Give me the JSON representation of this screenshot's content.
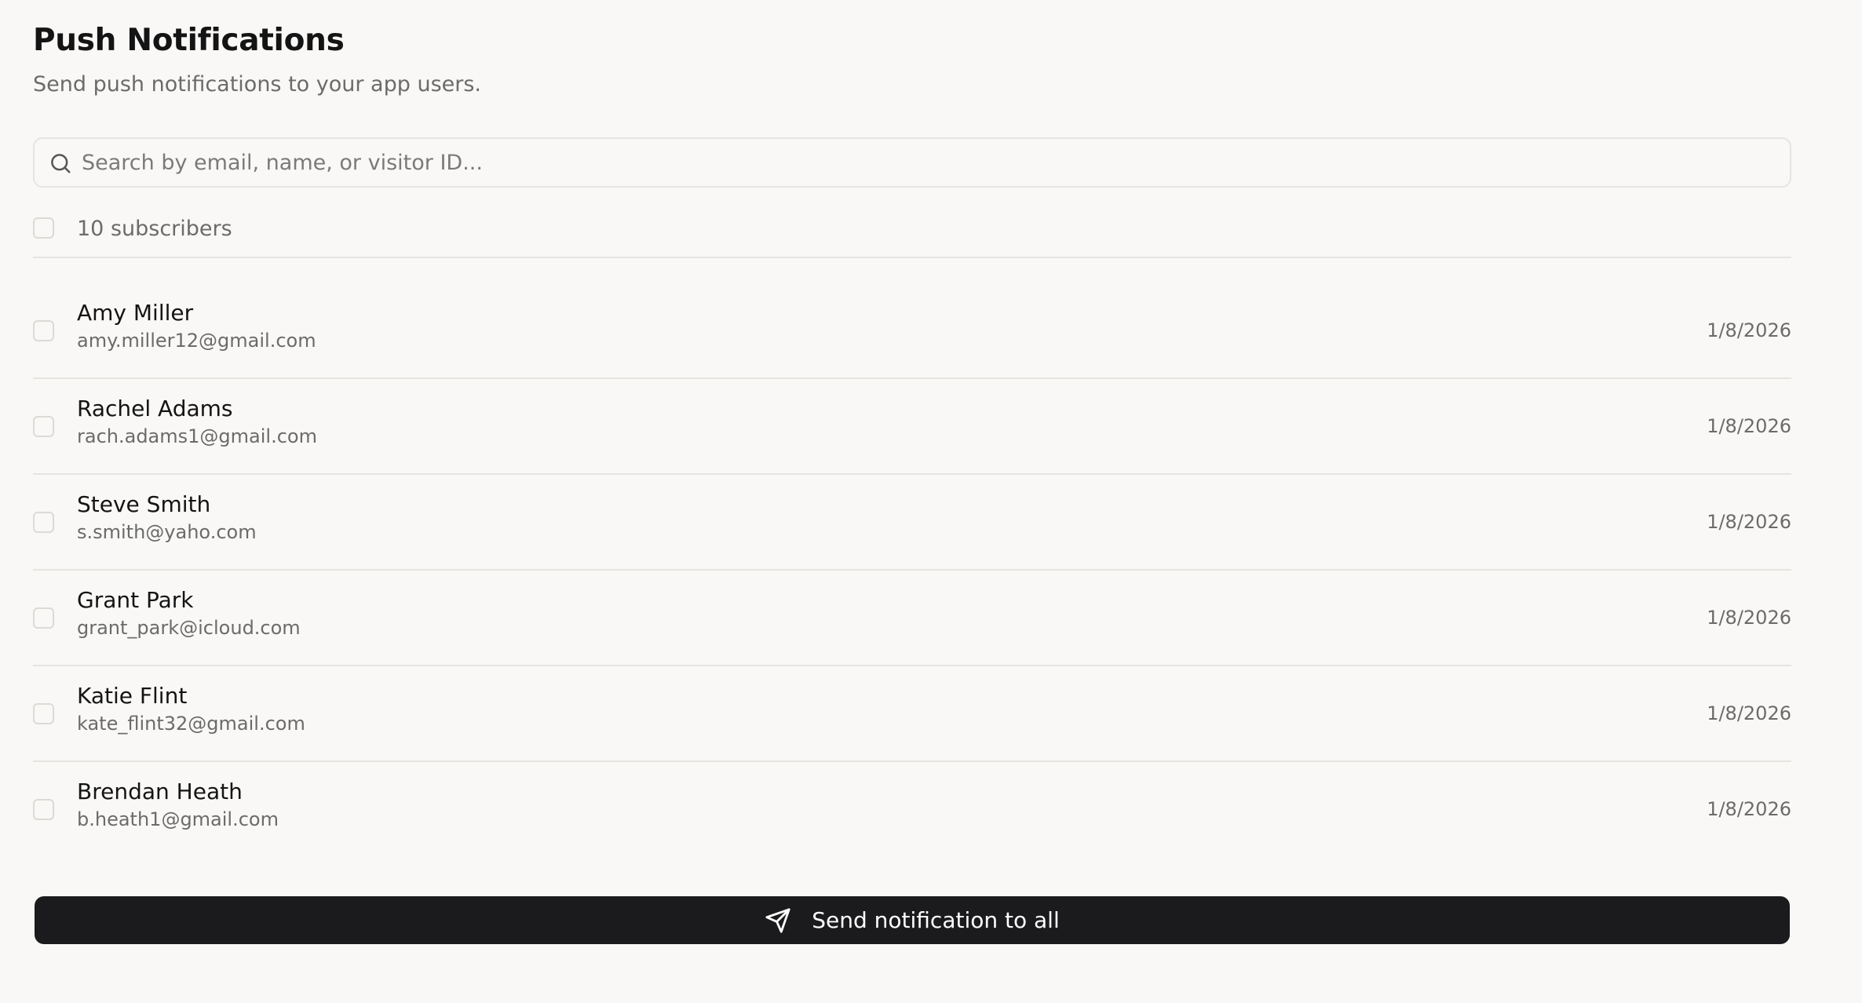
{
  "header": {
    "title": "Push Notifications",
    "subtitle": "Send push notifications to your app users."
  },
  "search": {
    "placeholder": "Search by email, name, or visitor ID...",
    "value": "",
    "icon": "search-icon"
  },
  "list": {
    "count_label": "10 subscribers",
    "rows": [
      {
        "name": "Amy Miller",
        "email": "amy.miller12@gmail.com",
        "date": "1/8/2026"
      },
      {
        "name": "Rachel Adams",
        "email": "rach.adams1@gmail.com",
        "date": "1/8/2026"
      },
      {
        "name": "Steve Smith",
        "email": "s.smith@yaho.com",
        "date": "1/8/2026"
      },
      {
        "name": "Grant Park",
        "email": "grant_park@icloud.com",
        "date": "1/8/2026"
      },
      {
        "name": "Katie Flint",
        "email": "kate_flint32@gmail.com",
        "date": "1/8/2026"
      },
      {
        "name": "Brendan Heath",
        "email": "b.heath1@gmail.com",
        "date": "1/8/2026"
      }
    ]
  },
  "footer": {
    "send_label": "Send notification to all",
    "send_icon": "send-icon"
  },
  "colors": {
    "background": "#f9f8f6",
    "primary_button": "#1b1b1d",
    "border": "#e6e4e0",
    "muted_text": "#6b6b6b"
  }
}
